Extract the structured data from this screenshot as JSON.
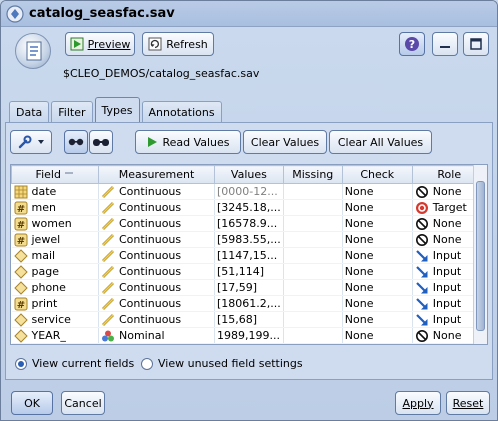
{
  "window": {
    "title": "catalog_seasfac.sav"
  },
  "toolbar": {
    "preview_label": "Preview",
    "refresh_label": "Refresh"
  },
  "path": "$CLEO_DEMOS/catalog_seasfac.sav",
  "tabs": [
    "Data",
    "Filter",
    "Types",
    "Annotations"
  ],
  "active_tab": "Types",
  "types_toolbar": {
    "read_values": "Read Values",
    "clear_values": "Clear Values",
    "clear_all_values": "Clear All Values"
  },
  "columns": [
    "Field",
    "Measurement",
    "Values",
    "Missing",
    "Check",
    "Role"
  ],
  "rows": [
    {
      "field": "date",
      "field_icon": "date-type-icon",
      "measurement": "Continuous",
      "values": "[0000-12...",
      "values_muted": true,
      "missing": "",
      "check": "None",
      "role": "None",
      "role_icon": "none-role-icon"
    },
    {
      "field": "men",
      "field_icon": "numeric-type-icon",
      "measurement": "Continuous",
      "values": "[3245.18,...",
      "values_muted": false,
      "missing": "",
      "check": "None",
      "role": "Target",
      "role_icon": "target-role-icon"
    },
    {
      "field": "women",
      "field_icon": "numeric-type-icon",
      "measurement": "Continuous",
      "values": "[16578.9...",
      "values_muted": false,
      "missing": "",
      "check": "None",
      "role": "None",
      "role_icon": "none-role-icon"
    },
    {
      "field": "jewel",
      "field_icon": "numeric-type-icon",
      "measurement": "Continuous",
      "values": "[5983.55,...",
      "values_muted": false,
      "missing": "",
      "check": "None",
      "role": "None",
      "role_icon": "none-role-icon"
    },
    {
      "field": "mail",
      "field_icon": "integer-type-icon",
      "measurement": "Continuous",
      "values": "[1147,15...",
      "values_muted": false,
      "missing": "",
      "check": "None",
      "role": "Input",
      "role_icon": "input-role-icon"
    },
    {
      "field": "page",
      "field_icon": "integer-type-icon",
      "measurement": "Continuous",
      "values": "[51,114]",
      "values_muted": false,
      "missing": "",
      "check": "None",
      "role": "Input",
      "role_icon": "input-role-icon"
    },
    {
      "field": "phone",
      "field_icon": "integer-type-icon",
      "measurement": "Continuous",
      "values": "[17,59]",
      "values_muted": false,
      "missing": "",
      "check": "None",
      "role": "Input",
      "role_icon": "input-role-icon"
    },
    {
      "field": "print",
      "field_icon": "numeric-type-icon",
      "measurement": "Continuous",
      "values": "[18061.2,...",
      "values_muted": false,
      "missing": "",
      "check": "None",
      "role": "Input",
      "role_icon": "input-role-icon"
    },
    {
      "field": "service",
      "field_icon": "integer-type-icon",
      "measurement": "Continuous",
      "values": "[15,68]",
      "values_muted": false,
      "missing": "",
      "check": "None",
      "role": "Input",
      "role_icon": "input-role-icon"
    },
    {
      "field": "YEAR_",
      "field_icon": "integer-type-icon",
      "measurement": "Nominal",
      "values": "1989,199...",
      "values_muted": false,
      "missing": "",
      "check": "None",
      "role": "None",
      "role_icon": "none-role-icon"
    }
  ],
  "view_options": {
    "current": "View current fields",
    "unused": "View unused field settings",
    "selected": "current"
  },
  "footer": {
    "ok": "OK",
    "cancel": "Cancel",
    "apply": "Apply",
    "reset": "Reset"
  }
}
